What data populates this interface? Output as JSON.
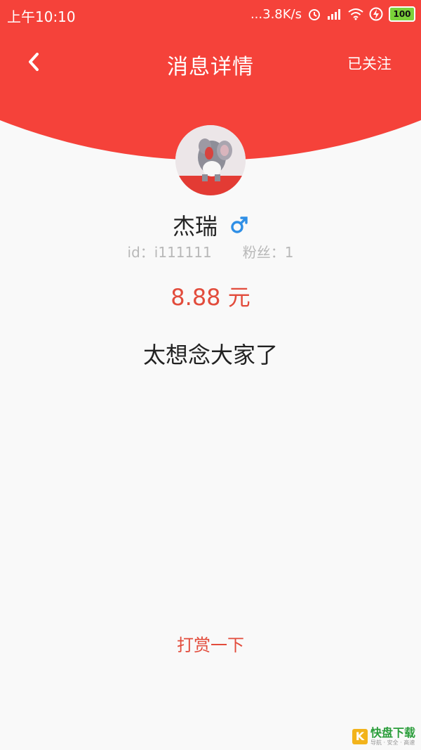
{
  "colors": {
    "accent": "#f5423a",
    "amount": "#e24c3c",
    "gender": "#2f8fe6"
  },
  "status_bar": {
    "time": "上午10:10",
    "network": "...3.8K/s",
    "battery": "100",
    "icons": [
      "alarm-icon",
      "signal-icon",
      "wifi-icon",
      "charging-icon",
      "battery-icon"
    ]
  },
  "header": {
    "title": "消息详情",
    "follow_label": "已关注",
    "back_icon": "chevron-left-icon"
  },
  "profile": {
    "name": "杰瑞",
    "gender_icon": "male-icon",
    "id_text": "id：i111111",
    "fans_text": "粉丝：1"
  },
  "message": {
    "amount": "8.88 元",
    "text": "太想念大家了"
  },
  "actions": {
    "tip_label": "打赏一下"
  },
  "watermark": {
    "logo": "K",
    "main": "快盘下载",
    "sub": "导航 · 安全 · 高速"
  }
}
